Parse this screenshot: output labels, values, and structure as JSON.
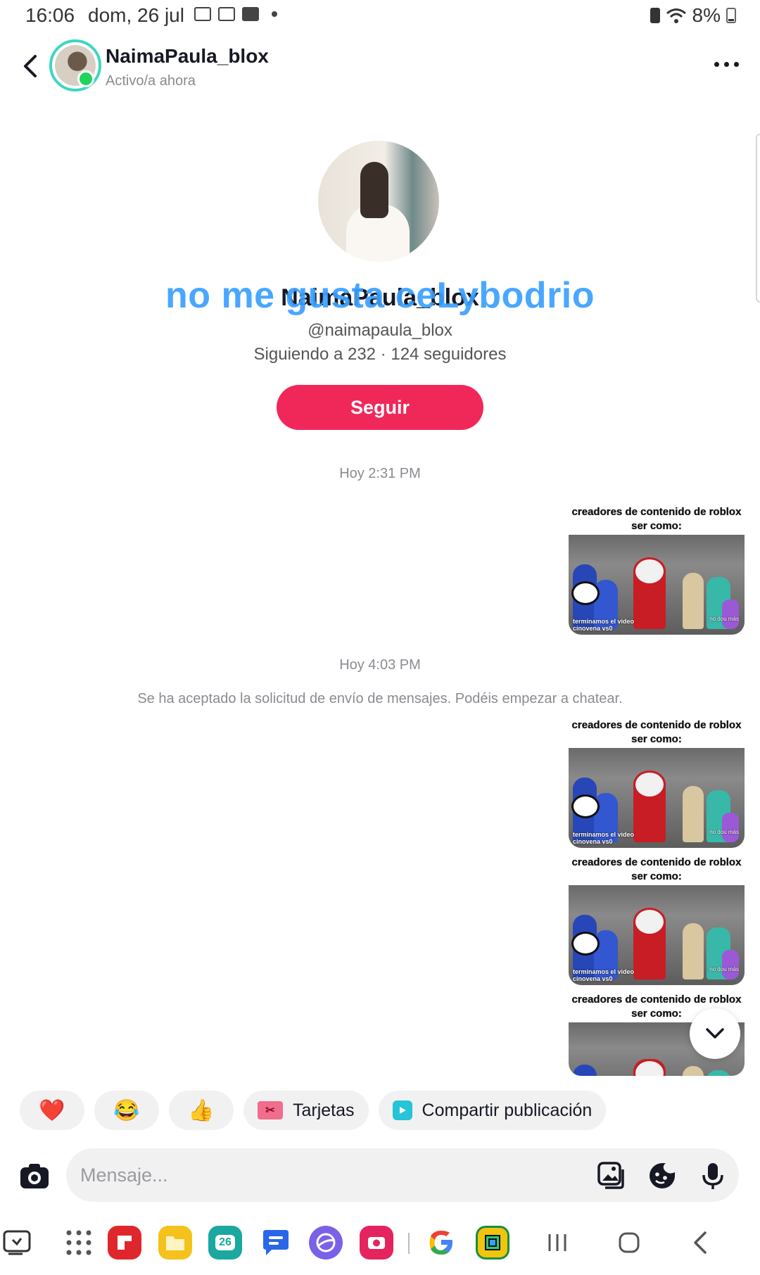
{
  "status_bar": {
    "time": "16:06",
    "date": "dom, 26 jul",
    "battery": "8%"
  },
  "header": {
    "username": "NaimaPaula_blox",
    "status": "Activo/a ahora"
  },
  "profile": {
    "name": "NaimaPaula_blox",
    "handle": "@naimapaula_blox",
    "stats": "Siguiendo a 232 · 124 seguidores",
    "follow_label": "Seguir"
  },
  "overlay_caption": "no me gusta ceLybodrio",
  "messages": {
    "timestamp_1": "Hoy 2:31 PM",
    "timestamp_2": "Hoy 4:03 PM",
    "system_notice": "Se ha aceptado la solicitud de envío de mensajes. Podéis empezar a chatear.",
    "meme_title": "creadores de contenido de roblox ser como:",
    "meme_caption_left": "terminamos el video",
    "meme_caption_left2": "cinovena vs0",
    "meme_caption_right": "no dou más"
  },
  "quick_replies": {
    "heart": "❤️",
    "laugh": "😂",
    "thumbs": "👍",
    "cards": "Tarjetas",
    "share": "Compartir publicación"
  },
  "composer": {
    "placeholder": "Mensaje..."
  },
  "navbar": {
    "calendar_day": "26"
  },
  "colors": {
    "accent": "#f0285a",
    "online": "#1fd35b",
    "caption": "#3aa0ff",
    "avatar_ring": "#3cd7c3"
  }
}
